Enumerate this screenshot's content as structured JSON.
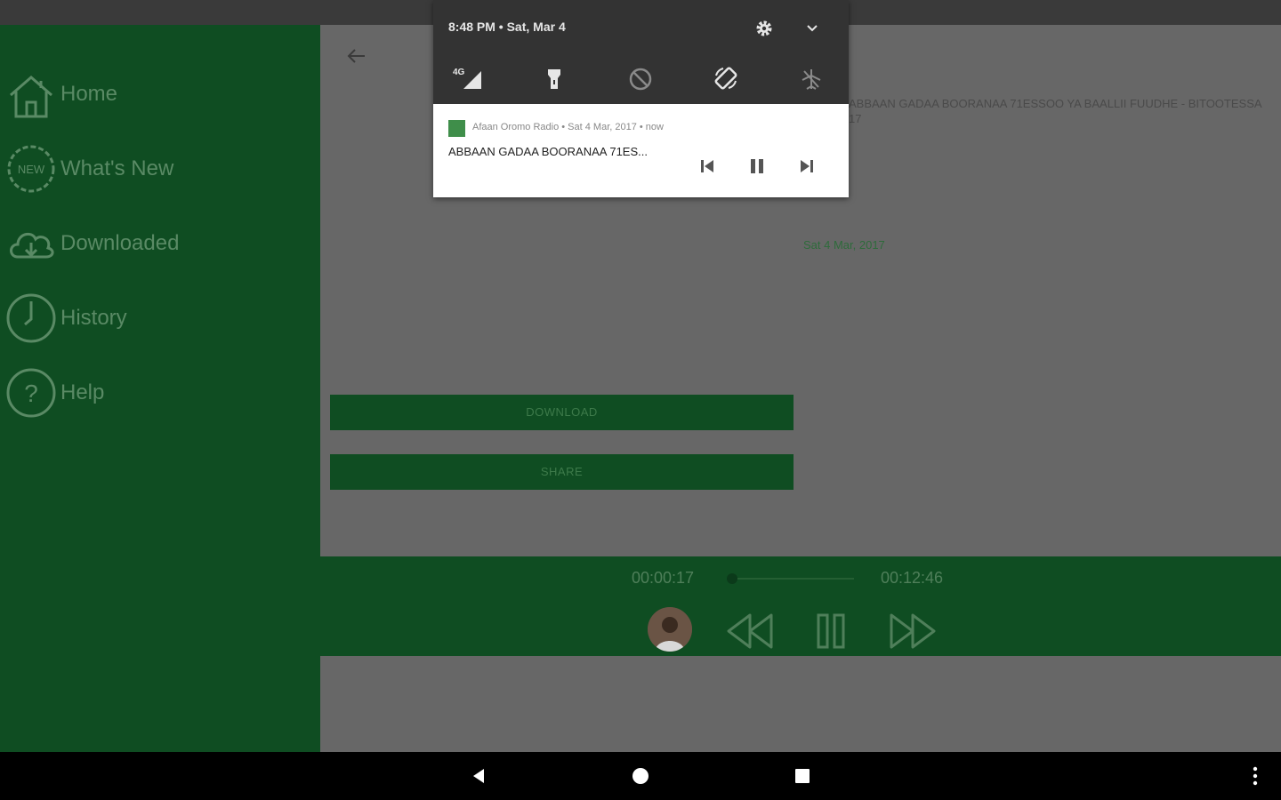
{
  "statusbar": {},
  "sidebar": {
    "items": [
      {
        "label": "Home",
        "icon": "home-icon"
      },
      {
        "label": "What's New",
        "icon": "new-badge-icon"
      },
      {
        "label": "Downloaded",
        "icon": "cloud-download-icon"
      },
      {
        "label": "History",
        "icon": "clock-icon"
      },
      {
        "label": "Help",
        "icon": "help-icon"
      }
    ]
  },
  "content": {
    "title_line1": "ABBAAN GADAA BOORANAA 71ESSOO YA BAALLII FUUDHE - BITOOTESSA",
    "title_line2": "17",
    "date": "Sat 4 Mar, 2017",
    "download_label": "DOWNLOAD",
    "share_label": "SHARE"
  },
  "player": {
    "elapsed": "00:00:17",
    "total": "00:12:46",
    "progress_fraction": 0.022
  },
  "shade": {
    "time": "8:48 PM • Sat, Mar 4",
    "quick_settings": [
      "signal-4g-icon",
      "flashlight-icon",
      "do-not-disturb-icon",
      "auto-rotate-icon",
      "airplane-mode-icon"
    ],
    "signal_label": "4G",
    "notification": {
      "header": "Afaan Oromo Radio • Sat 4 Mar, 2017 • now",
      "title": "ABBAAN GADAA BOORANAA 71ES..."
    }
  },
  "colors": {
    "sidebar_bg": "#0f4d22",
    "content_bg": "#676767",
    "shade_bg": "#333333",
    "accent_green": "#0f4d22"
  }
}
